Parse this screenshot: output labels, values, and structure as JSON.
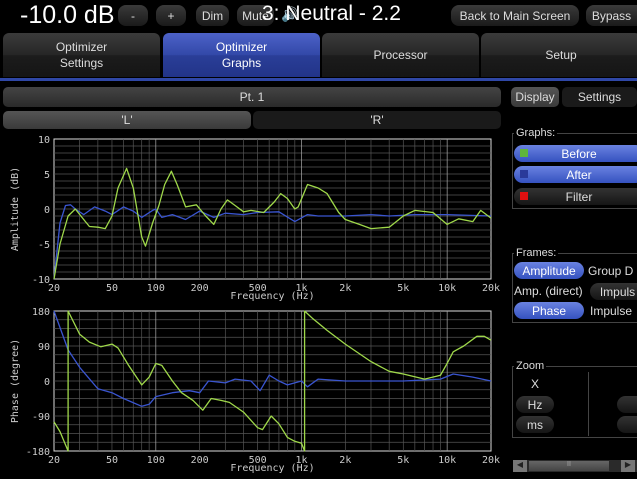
{
  "topbar": {
    "volume": "-10.0 dB",
    "minus": "-",
    "plus": "+",
    "dim": "Dim",
    "mute": "Mute",
    "speaker_icon": "speaker-icon",
    "preset": "3: Neutral - 2.2",
    "back": "Back to Main Screen",
    "bypass": "Bypass"
  },
  "tabs": [
    {
      "label": "Optimizer\nSettings"
    },
    {
      "label": "Optimizer\nGraphs"
    },
    {
      "label": "Processor"
    },
    {
      "label": "Setup"
    }
  ],
  "point": "Pt. 1",
  "channels": [
    "'L'",
    "'R'"
  ],
  "side_tabs": [
    "Display",
    "Settings"
  ],
  "graphs": {
    "title": "Graphs:",
    "items": [
      {
        "label": "Before",
        "color": "#5fb53a",
        "on": true
      },
      {
        "label": "After",
        "color": "#2a3a9a",
        "on": true
      },
      {
        "label": "Filter",
        "color": "#e01010",
        "on": false
      }
    ]
  },
  "frames": {
    "title": "Frames:",
    "items": [
      [
        "Amplitude",
        "Group D"
      ],
      [
        "Amp. (direct)",
        "Impuls"
      ],
      [
        "Phase",
        "Impulse"
      ]
    ]
  },
  "zoom": {
    "title": "Zoom",
    "x": "X",
    "hz": "Hz",
    "ms": "ms"
  },
  "scroll_thumb": "II",
  "chart_data": [
    {
      "type": "line",
      "xlabel": "Frequency (Hz)",
      "ylabel": "Amplitude (dB)",
      "xscale": "log",
      "xlim": [
        20,
        20000
      ],
      "ylim": [
        -10,
        10
      ],
      "xticks": [
        [
          20,
          "20"
        ],
        [
          50,
          "50"
        ],
        [
          100,
          "100"
        ],
        [
          200,
          "200"
        ],
        [
          500,
          "500"
        ],
        [
          1000,
          "1k"
        ],
        [
          2000,
          "2k"
        ],
        [
          5000,
          "5k"
        ],
        [
          10000,
          "10k"
        ],
        [
          20000,
          "20k"
        ]
      ],
      "yticks": [
        10,
        5,
        0,
        -5,
        -10
      ],
      "grid": true,
      "series": [
        {
          "name": "Before",
          "color": "#9fd84a",
          "points": [
            [
              20,
              -10
            ],
            [
              22,
              -5
            ],
            [
              25,
              -1
            ],
            [
              28,
              0
            ],
            [
              32,
              -1.5
            ],
            [
              35,
              -2.5
            ],
            [
              40,
              -2.6
            ],
            [
              45,
              -2.8
            ],
            [
              50,
              -1
            ],
            [
              55,
              3
            ],
            [
              63,
              5.8
            ],
            [
              70,
              3
            ],
            [
              80,
              -4
            ],
            [
              85,
              -5.3
            ],
            [
              95,
              -2
            ],
            [
              105,
              0.5
            ],
            [
              115,
              3.5
            ],
            [
              128,
              5.4
            ],
            [
              140,
              3.5
            ],
            [
              160,
              0.3
            ],
            [
              190,
              0.6
            ],
            [
              220,
              -1
            ],
            [
              250,
              -2.2
            ],
            [
              280,
              0
            ],
            [
              310,
              1.3
            ],
            [
              350,
              0.5
            ],
            [
              400,
              -0.4
            ],
            [
              450,
              -0.2
            ],
            [
              550,
              -0.5
            ],
            [
              650,
              1
            ],
            [
              720,
              2.2
            ],
            [
              800,
              1.5
            ],
            [
              900,
              0
            ],
            [
              950,
              0.3
            ],
            [
              1100,
              3.5
            ],
            [
              1300,
              3
            ],
            [
              1500,
              2.2
            ],
            [
              1800,
              -0.5
            ],
            [
              2000,
              -1.5
            ],
            [
              2500,
              -2.2
            ],
            [
              3000,
              -2.8
            ],
            [
              4000,
              -2.6
            ],
            [
              5000,
              -1
            ],
            [
              6000,
              -0.2
            ],
            [
              8000,
              -0.5
            ],
            [
              10000,
              -2.2
            ],
            [
              12000,
              -1.4
            ],
            [
              15000,
              -1.8
            ],
            [
              17000,
              -0.2
            ],
            [
              20000,
              -1.3
            ]
          ]
        },
        {
          "name": "After",
          "color": "#3a55d0",
          "points": [
            [
              20,
              -10
            ],
            [
              22,
              -2
            ],
            [
              24,
              0.5
            ],
            [
              26,
              0.6
            ],
            [
              28,
              0
            ],
            [
              32,
              -0.8
            ],
            [
              38,
              0.3
            ],
            [
              45,
              -0.3
            ],
            [
              50,
              -0.8
            ],
            [
              60,
              0.3
            ],
            [
              70,
              -0.3
            ],
            [
              80,
              -1.2
            ],
            [
              95,
              -0.2
            ],
            [
              100,
              0
            ],
            [
              110,
              -1.2
            ],
            [
              130,
              -0.8
            ],
            [
              160,
              -1.5
            ],
            [
              200,
              -0.3
            ],
            [
              250,
              -1.2
            ],
            [
              300,
              -0.6
            ],
            [
              400,
              -0.8
            ],
            [
              500,
              -0.5
            ],
            [
              700,
              -0.4
            ],
            [
              900,
              -1.8
            ],
            [
              1100,
              -0.8
            ],
            [
              1300,
              -1
            ],
            [
              2000,
              -1
            ],
            [
              3000,
              -0.8
            ],
            [
              4000,
              -1
            ],
            [
              6000,
              -0.8
            ],
            [
              10000,
              -0.8
            ],
            [
              20000,
              -1
            ]
          ]
        }
      ]
    },
    {
      "type": "line",
      "xlabel": "Frequency (Hz)",
      "ylabel": "Phase (degree)",
      "xscale": "log",
      "xlim": [
        20,
        20000
      ],
      "ylim": [
        -180,
        180
      ],
      "xticks": [
        [
          20,
          "20"
        ],
        [
          50,
          "50"
        ],
        [
          100,
          "100"
        ],
        [
          200,
          "200"
        ],
        [
          500,
          "500"
        ],
        [
          1000,
          "1k"
        ],
        [
          2000,
          "2k"
        ],
        [
          5000,
          "5k"
        ],
        [
          10000,
          "10k"
        ],
        [
          20000,
          "20k"
        ]
      ],
      "yticks": [
        180,
        90,
        0,
        -90,
        -180
      ],
      "grid": true,
      "series": [
        {
          "name": "Before",
          "color": "#9fd84a",
          "points": [
            [
              20,
              -105
            ],
            [
              22,
              -130
            ],
            [
              25,
              -180
            ],
            [
              25.01,
              180
            ],
            [
              30,
              120
            ],
            [
              35,
              100
            ],
            [
              42,
              88
            ],
            [
              50,
              95
            ],
            [
              55,
              85
            ],
            [
              65,
              40
            ],
            [
              80,
              -10
            ],
            [
              90,
              10
            ],
            [
              100,
              45
            ],
            [
              110,
              40
            ],
            [
              130,
              0
            ],
            [
              150,
              -30
            ],
            [
              180,
              -50
            ],
            [
              210,
              -75
            ],
            [
              240,
              -45
            ],
            [
              280,
              -50
            ],
            [
              320,
              -55
            ],
            [
              400,
              -80
            ],
            [
              500,
              -120
            ],
            [
              540,
              -125
            ],
            [
              620,
              -90
            ],
            [
              700,
              -110
            ],
            [
              800,
              -145
            ],
            [
              900,
              -155
            ],
            [
              1000,
              -160
            ],
            [
              1050,
              -180
            ],
            [
              1050.1,
              180
            ],
            [
              1200,
              160
            ],
            [
              1500,
              130
            ],
            [
              2000,
              95
            ],
            [
              3000,
              50
            ],
            [
              4000,
              25
            ],
            [
              5000,
              18
            ],
            [
              7000,
              5
            ],
            [
              9000,
              15
            ],
            [
              10000,
              45
            ],
            [
              11000,
              75
            ],
            [
              13000,
              90
            ],
            [
              16000,
              115
            ],
            [
              18000,
              115
            ],
            [
              20000,
              105
            ]
          ]
        },
        {
          "name": "After",
          "color": "#3a55d0",
          "points": [
            [
              20,
              180
            ],
            [
              25,
              80
            ],
            [
              30,
              35
            ],
            [
              40,
              -20
            ],
            [
              50,
              -30
            ],
            [
              60,
              -45
            ],
            [
              80,
              -65
            ],
            [
              90,
              -60
            ],
            [
              100,
              -40
            ],
            [
              130,
              -30
            ],
            [
              170,
              -25
            ],
            [
              200,
              -30
            ],
            [
              230,
              0
            ],
            [
              300,
              -5
            ],
            [
              350,
              5
            ],
            [
              450,
              0
            ],
            [
              520,
              -25
            ],
            [
              600,
              15
            ],
            [
              700,
              0
            ],
            [
              800,
              -10
            ],
            [
              1000,
              0
            ],
            [
              1100,
              -15
            ],
            [
              1300,
              5
            ],
            [
              2000,
              0
            ],
            [
              5000,
              0
            ],
            [
              9000,
              5
            ],
            [
              11000,
              18
            ],
            [
              15000,
              10
            ],
            [
              20000,
              0
            ]
          ]
        }
      ]
    }
  ]
}
